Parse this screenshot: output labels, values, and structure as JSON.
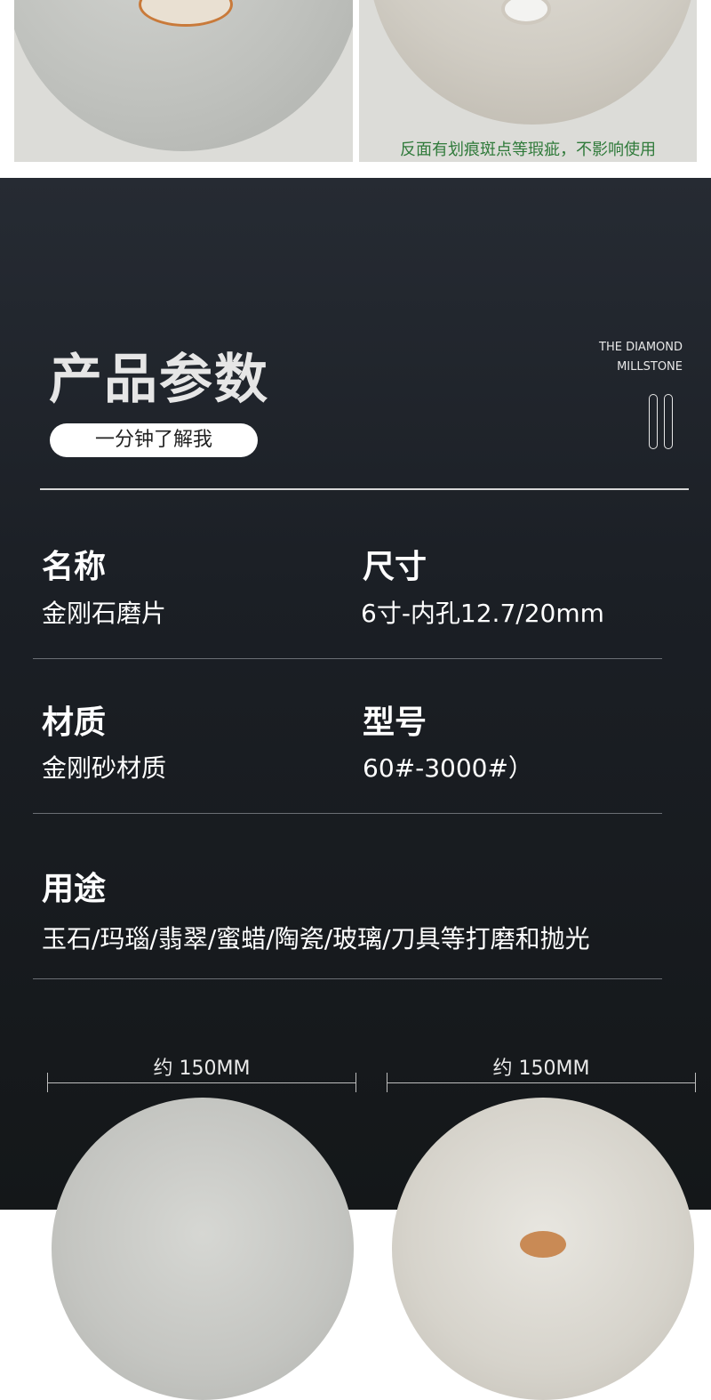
{
  "top": {
    "note": "反面有划痕斑点等瑕疵，不影响使用"
  },
  "params": {
    "title": "产品参数",
    "subtitle_button": "一分钟了解我",
    "english_line1": "THE DIAMOND",
    "english_line2": "MILLSTONE",
    "rows": [
      {
        "label": "名称",
        "value": "金刚石磨片"
      },
      {
        "label": "尺寸",
        "value": "6寸-内孔12.7/20mm"
      },
      {
        "label": "材质",
        "value": "金刚砂材质"
      },
      {
        "label": "型号",
        "value": "60#-3000#）"
      },
      {
        "label": "用途",
        "value": "玉石/玛瑙/翡翠/蜜蜡/陶瓷/玻璃/刀具等打磨和抛光"
      }
    ]
  },
  "dimensions": {
    "left": "约 150MM",
    "right": "约 150MM"
  },
  "colors": {
    "note_green": "#2f7a3a",
    "dark_bg": "#1b1f25",
    "text": "#ffffff"
  }
}
